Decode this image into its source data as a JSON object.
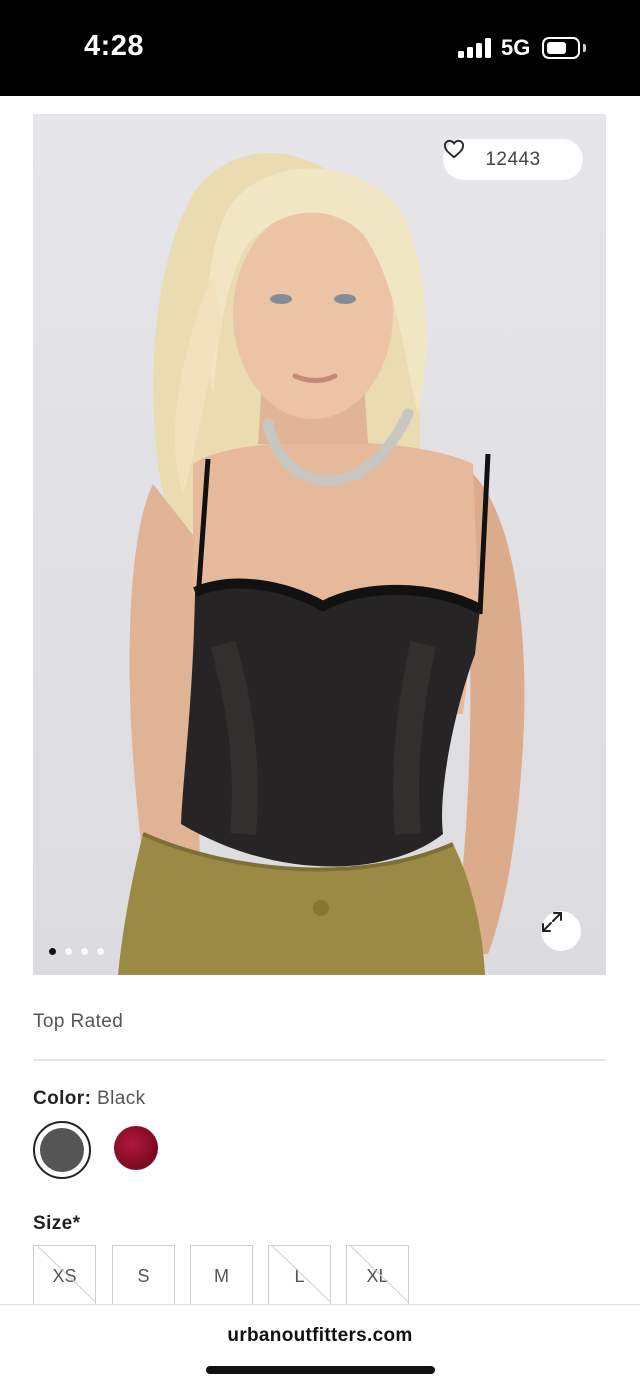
{
  "status_bar": {
    "time": "4:28",
    "network": "5G",
    "icons": [
      "signal-icon",
      "battery-icon"
    ]
  },
  "product": {
    "favorites_count": "12443",
    "favorite_icon": "heart-icon",
    "expand_icon": "expand-icon",
    "carousel": {
      "total": 4,
      "active_index": 0
    },
    "badge": "Top Rated",
    "color": {
      "label": "Color:",
      "selected": "Black",
      "swatches": [
        {
          "name": "Black",
          "hex": "#555555",
          "selected": true
        },
        {
          "name": "Red",
          "hex": "#8a0d22",
          "selected": false
        }
      ]
    },
    "size": {
      "label": "Size*",
      "options": [
        {
          "label": "XS",
          "available": false
        },
        {
          "label": "S",
          "available": true
        },
        {
          "label": "M",
          "available": true
        },
        {
          "label": "L",
          "available": false
        },
        {
          "label": "XL",
          "available": false
        }
      ]
    }
  },
  "browser": {
    "url": "urbanoutfitters.com"
  }
}
